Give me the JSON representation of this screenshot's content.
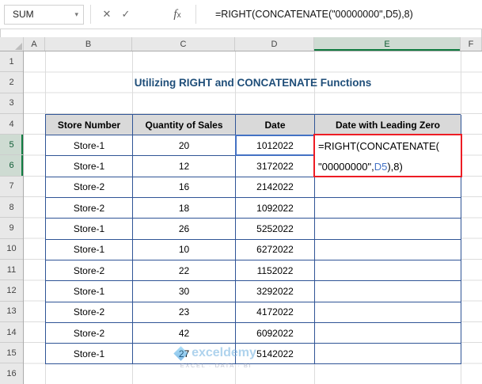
{
  "formula_bar": {
    "name_box_value": "SUM",
    "formula": "=RIGHT(CONCATENATE(\"00000000\",D5),8)",
    "icons": {
      "dropdown": "▾",
      "cancel": "✕",
      "enter": "✓",
      "fx_f": "f",
      "fx_x": "x"
    }
  },
  "column_headers": [
    "A",
    "B",
    "C",
    "D",
    "E",
    "F"
  ],
  "row_headers": [
    "1",
    "2",
    "3",
    "4",
    "5",
    "6",
    "7",
    "8",
    "9",
    "10",
    "11",
    "12",
    "13",
    "14",
    "15",
    "16"
  ],
  "selection": {
    "active_column": "E",
    "active_rows": [
      "5",
      "6"
    ],
    "reference_cell": "D5"
  },
  "sheet": {
    "title": "Utilizing RIGHT and CONCATENATE Functions",
    "table": {
      "headers": [
        "Store Number",
        "Quantity of Sales",
        "Date",
        "Date with Leading Zero"
      ],
      "rows": [
        [
          "Store-1",
          "20",
          "1012022"
        ],
        [
          "Store-1",
          "12",
          "3172022"
        ],
        [
          "Store-2",
          "16",
          "2142022"
        ],
        [
          "Store-2",
          "18",
          "1092022"
        ],
        [
          "Store-1",
          "26",
          "5252022"
        ],
        [
          "Store-1",
          "10",
          "6272022"
        ],
        [
          "Store-2",
          "22",
          "1152022"
        ],
        [
          "Store-1",
          "30",
          "3292022"
        ],
        [
          "Store-2",
          "23",
          "4172022"
        ],
        [
          "Store-2",
          "42",
          "6092022"
        ],
        [
          "Store-1",
          "27",
          "5142022"
        ]
      ]
    },
    "active_cell_formula": {
      "line1": "=RIGHT(CONCATENATE(",
      "line2_before_ref": "\"00000000\",",
      "line2_ref": "D5",
      "line2_after_ref": "),8)"
    }
  },
  "watermark": {
    "brand": "exceldemy",
    "tagline": "EXCEL · DATA · BI"
  },
  "colors": {
    "excel_green": "#107C41",
    "table_border_blue": "#2F5496",
    "title_blue": "#1F4E79",
    "annotation_red": "#ED1C24",
    "reference_blue": "#4472C4",
    "table_header_fill": "#D9D9D9"
  }
}
